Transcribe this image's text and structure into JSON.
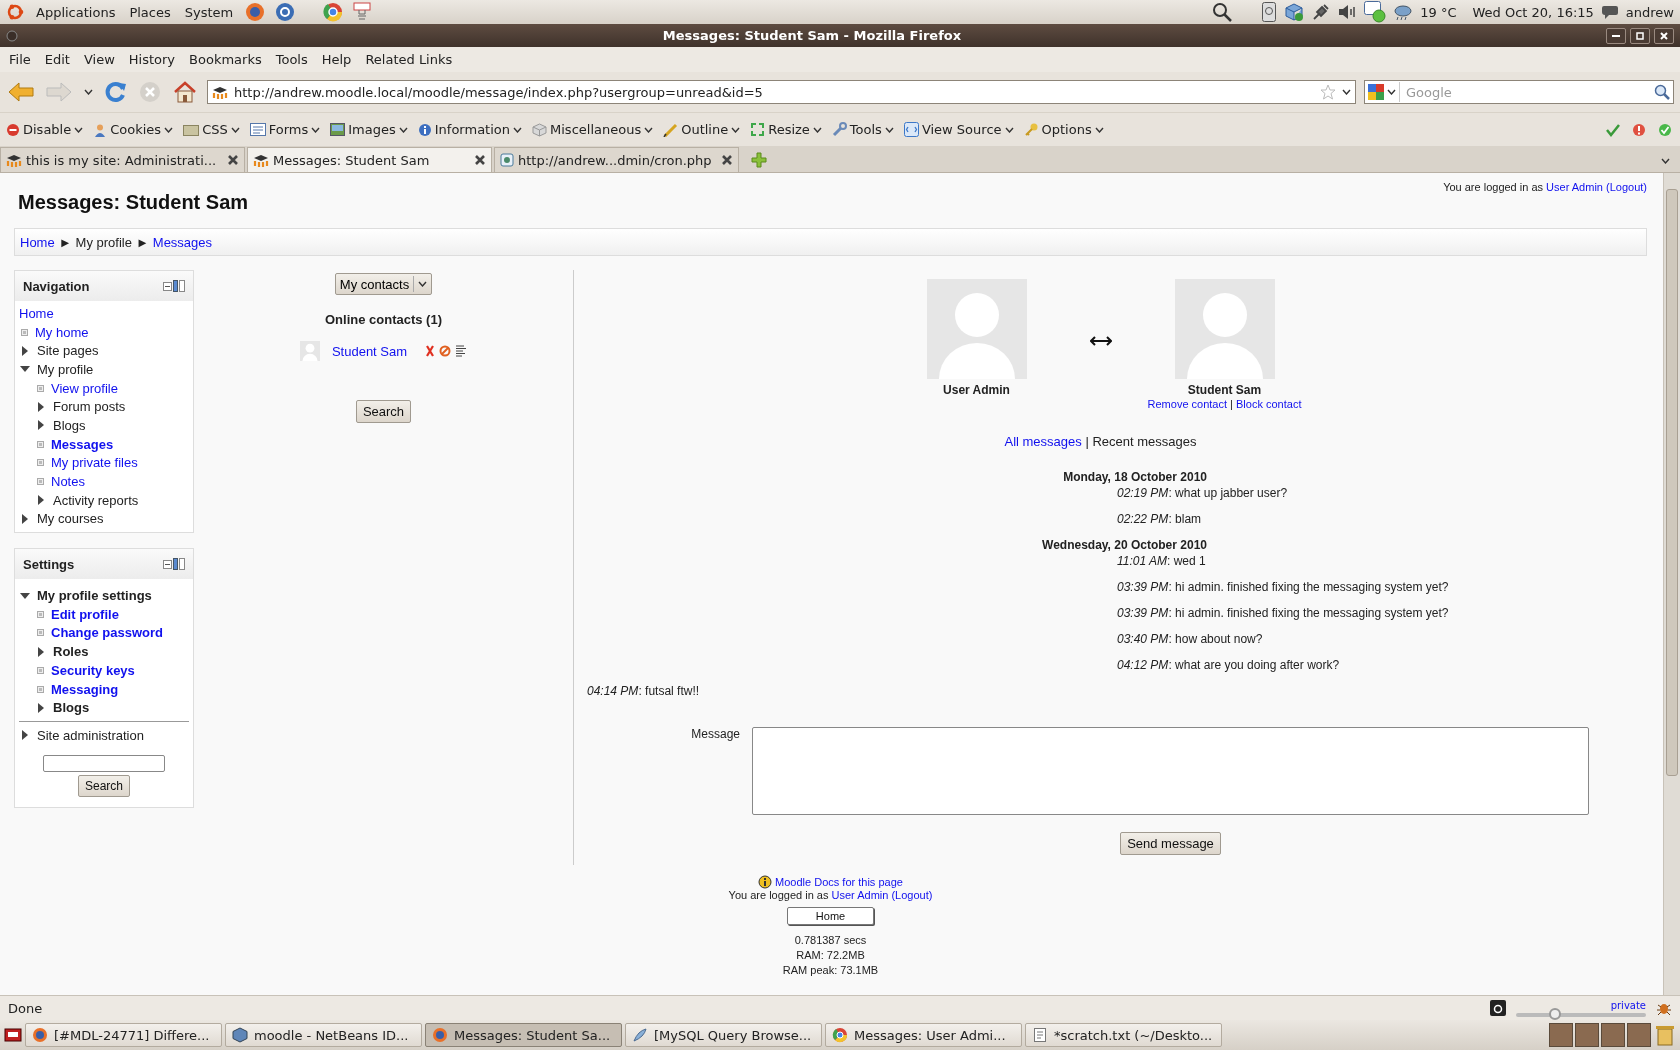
{
  "top_panel": {
    "menus": [
      "Applications",
      "Places",
      "System"
    ],
    "weather": "19 °C",
    "clock": "Wed Oct 20, 16:15",
    "user": "andrew"
  },
  "window": {
    "title": "Messages: Student Sam - Mozilla Firefox"
  },
  "menu_bar": [
    "File",
    "Edit",
    "View",
    "History",
    "Bookmarks",
    "Tools",
    "Help",
    "Related Links"
  ],
  "address_bar": {
    "url": "http://andrew.moodle.local/moodle/message/index.php?usergroup=unread&id=5"
  },
  "search": {
    "placeholder": "Google"
  },
  "dev_toolbar": [
    "Disable",
    "Cookies",
    "CSS",
    "Forms",
    "Images",
    "Information",
    "Miscellaneous",
    "Outline",
    "Resize",
    "Tools",
    "View Source",
    "Options"
  ],
  "tabs": [
    {
      "label": "this is my site: Administrati...",
      "selected": false
    },
    {
      "label": "Messages: Student Sam",
      "selected": true
    },
    {
      "label": "http://andrew...dmin/cron.php",
      "selected": false
    }
  ],
  "page": {
    "title": "Messages: Student Sam",
    "login": {
      "prefix": "You are logged in as",
      "user": "User Admin",
      "logout": "(Logout)"
    },
    "breadcrumb": {
      "separator": "►",
      "items": [
        {
          "label": "Home",
          "link": true
        },
        {
          "label": "My profile",
          "link": false
        },
        {
          "label": "Messages",
          "link": true
        }
      ]
    }
  },
  "navigation": {
    "title": "Navigation",
    "root": {
      "label": "Home",
      "link": true,
      "current": false,
      "children": [
        {
          "label": "My home",
          "link": true,
          "current": false
        },
        {
          "label": "Site pages",
          "link": false,
          "current": false,
          "expanded": false
        },
        {
          "label": "My profile",
          "link": false,
          "current": false,
          "expanded": true,
          "children": [
            {
              "label": "View profile",
              "link": true,
              "current": false
            },
            {
              "label": "Forum posts",
              "link": false,
              "current": false,
              "expanded": false
            },
            {
              "label": "Blogs",
              "link": false,
              "current": false,
              "expanded": false
            },
            {
              "label": "Messages",
              "link": true,
              "current": true
            },
            {
              "label": "My private files",
              "link": true,
              "current": false
            },
            {
              "label": "Notes",
              "link": true,
              "current": false
            },
            {
              "label": "Activity reports",
              "link": false,
              "current": false,
              "expanded": false
            }
          ]
        },
        {
          "label": "My courses",
          "link": false,
          "current": false,
          "expanded": false
        }
      ]
    }
  },
  "settings": {
    "title": "Settings",
    "tree": [
      {
        "label": "My profile settings",
        "link": false,
        "expanded": true,
        "children": [
          {
            "label": "Edit profile",
            "link": true
          },
          {
            "label": "Change password",
            "link": true
          },
          {
            "label": "Roles",
            "link": false,
            "expanded": false
          },
          {
            "label": "Security keys",
            "link": true
          },
          {
            "label": "Messaging",
            "link": true
          },
          {
            "label": "Blogs",
            "link": false,
            "expanded": false
          }
        ]
      }
    ],
    "admin": [
      {
        "label": "Site administration",
        "link": false,
        "expanded": false
      }
    ],
    "search_button": "Search"
  },
  "contacts": {
    "dropdown": "My contacts",
    "heading": "Online contacts (1)",
    "items": [
      {
        "name": "Student Sam"
      }
    ],
    "search_button": "Search"
  },
  "profiles": [
    {
      "name": "User Admin"
    },
    {
      "name": "Student Sam",
      "actions": [
        "Remove contact",
        "Block contact"
      ]
    }
  ],
  "action_separator": "|",
  "views": {
    "separator": "|",
    "items": [
      {
        "label": "All messages",
        "selected": false
      },
      {
        "label": "Recent messages",
        "selected": true
      }
    ]
  },
  "history": [
    {
      "date": "Monday, 18 October 2010",
      "messages": [
        {
          "kind": "received",
          "line": "*02:19 PM*: what up jabber user?"
        },
        {
          "kind": "received",
          "line": "*02:22 PM*: blam"
        }
      ]
    },
    {
      "date": "Wednesday, 20 October 2010",
      "messages": [
        {
          "kind": "received",
          "line": "*11:01 AM*: wed 1"
        },
        {
          "kind": "received",
          "line": "*03:39 PM*: hi admin. finished fixing the messaging system yet?"
        },
        {
          "kind": "received",
          "line": "*03:39 PM*: hi admin. finished fixing the messaging system yet?"
        },
        {
          "kind": "received",
          "line": "*03:40 PM*: how about now?"
        },
        {
          "kind": "received",
          "line": "*04:12 PM*: what are you doing after work?"
        },
        {
          "kind": "sent",
          "line": "*04:14 PM*: futsal ftw!!"
        }
      ]
    }
  ],
  "form": {
    "label": "Message",
    "button": "Send message"
  },
  "footer": {
    "docs": "Moodle Docs for this page",
    "login": {
      "prefix": "You are logged in as",
      "user": "User Admin",
      "logout": "(Logout)"
    },
    "home_button": "Home",
    "stats": [
      "0.781387 secs",
      "RAM: 72.2MB",
      "RAM peak: 73.1MB"
    ]
  },
  "status_bar": {
    "text": "Done",
    "private": "private",
    "level": 0.3
  },
  "taskbar": [
    {
      "label": "[#MDL-24771] Differe...",
      "selected": false
    },
    {
      "label": "moodle - NetBeans ID...",
      "selected": false
    },
    {
      "label": "Messages: Student Sa...",
      "selected": true
    },
    {
      "label": "[MySQL Query Browse...",
      "selected": false
    },
    {
      "label": "Messages: User Admi...",
      "selected": false
    },
    {
      "label": "*scratch.txt (~/Deskto...",
      "selected": false
    }
  ]
}
